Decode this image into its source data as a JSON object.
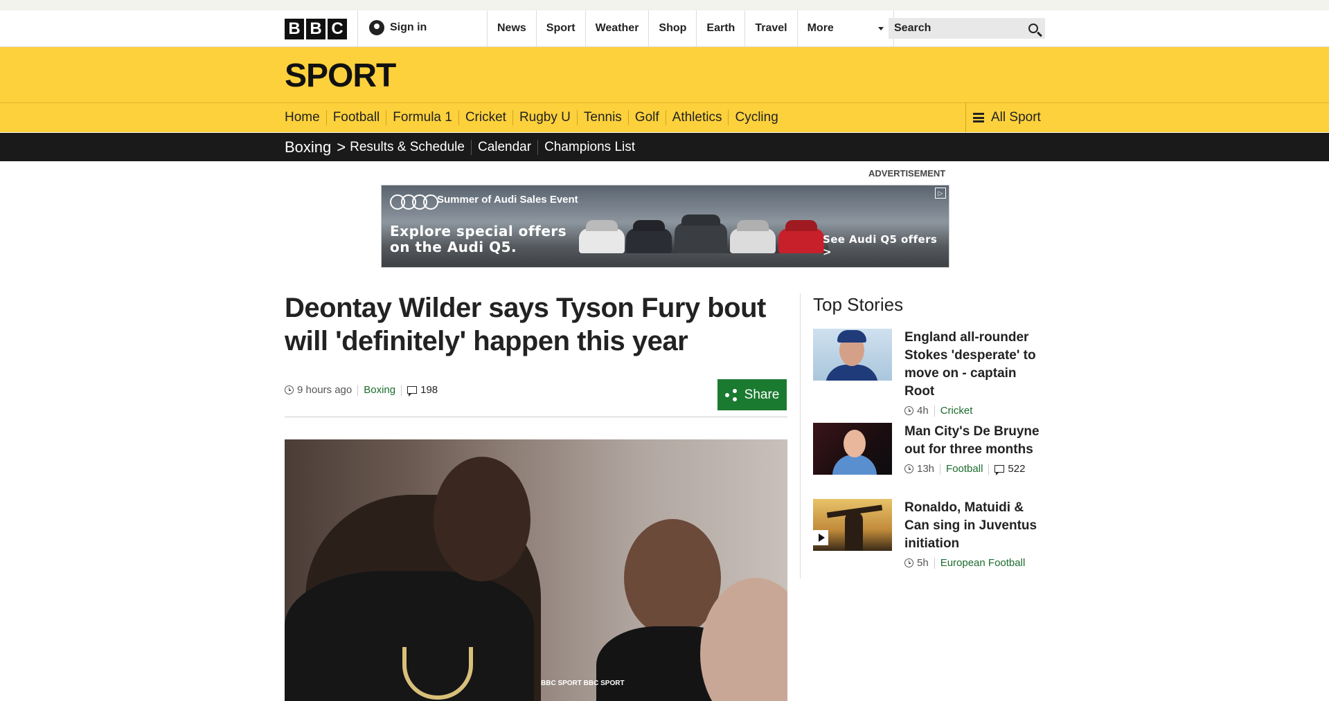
{
  "masthead": {
    "logo_letters": [
      "B",
      "B",
      "C"
    ],
    "signin_label": "Sign in",
    "nav": [
      "News",
      "Sport",
      "Weather",
      "Shop",
      "Earth",
      "Travel"
    ],
    "more_label": "More",
    "search_placeholder": "Search"
  },
  "sport": {
    "title": "SPORT",
    "nav": [
      "Home",
      "Football",
      "Formula 1",
      "Cricket",
      "Rugby U",
      "Tennis",
      "Golf",
      "Athletics",
      "Cycling"
    ],
    "all_sport_label": "All Sport"
  },
  "section_nav": {
    "section": "Boxing",
    "chevron": ">",
    "links": [
      "Results & Schedule",
      "Calendar",
      "Champions List"
    ]
  },
  "advert": {
    "label": "ADVERTISEMENT",
    "event": "Summer of Audi Sales Event",
    "headline_line1": "Explore special offers",
    "headline_line2": "on the Audi Q5.",
    "cta": "See Audi Q5 offers >"
  },
  "article": {
    "title": "Deontay Wilder says Tyson Fury bout will 'definitely' happen this year",
    "time": "9 hours ago",
    "tag": "Boxing",
    "comments": "198",
    "share_label": "Share",
    "image_watermark": "BBC SPORT BBC SPORT"
  },
  "top_stories": {
    "heading": "Top Stories",
    "items": [
      {
        "headline": "England all-rounder Stokes 'desperate' to move on - captain Root",
        "time": "4h",
        "tag": "Cricket"
      },
      {
        "headline": "Man City's De Bruyne out for three months",
        "time": "13h",
        "tag": "Football",
        "comments": "522"
      },
      {
        "headline": "Ronaldo, Matuidi & Can sing in Juventus initiation",
        "time": "5h",
        "tag": "European Football"
      }
    ]
  },
  "colors": {
    "sport_yellow": "#fdd13c",
    "section_black": "#1a1a1a",
    "share_green": "#1a7a30",
    "tag_green": "#1a6b2d"
  }
}
